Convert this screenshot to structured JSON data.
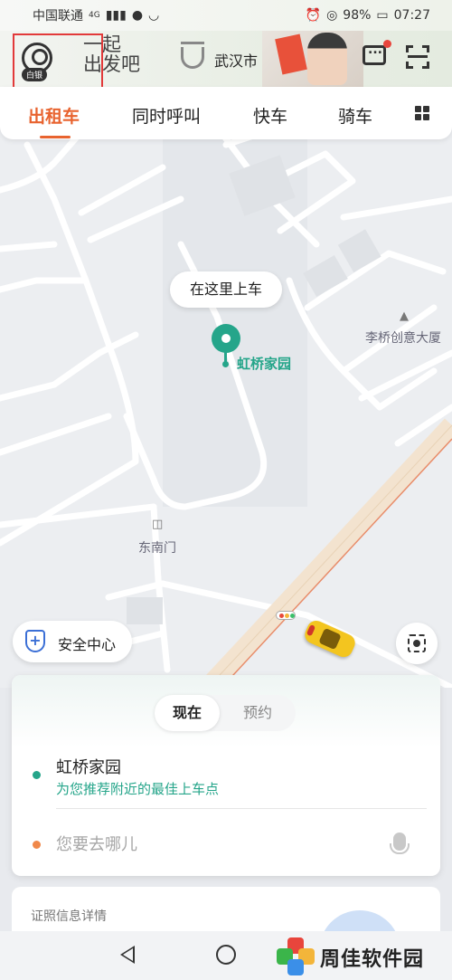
{
  "status_bar": {
    "carrier": "中国联通",
    "network": "4G",
    "battery": "98%",
    "time": "07:27"
  },
  "header": {
    "member_badge": "白银",
    "slogan_line1": "一起",
    "slogan_line2": "出发吧",
    "city": "武汉市"
  },
  "tabs": [
    {
      "label": "出租车",
      "active": true
    },
    {
      "label": "同时呼叫",
      "active": false
    },
    {
      "label": "快车",
      "active": false
    },
    {
      "label": "骑车",
      "active": false
    }
  ],
  "map": {
    "pickup_bubble": "在这里上车",
    "pickup_name": "虹桥家园",
    "poi_1": "李桥创意大厦",
    "poi_2": "东南门",
    "safety_center": "安全中心"
  },
  "booking": {
    "mode_now": "现在",
    "mode_later": "预约",
    "from_name": "虹桥家园",
    "from_hint": "为您推荐附近的最佳上车点",
    "to_placeholder": "您要去哪儿"
  },
  "license_card": {
    "label": "证照信息详情"
  },
  "watermark": {
    "text": "周佳软件园"
  },
  "colors": {
    "accent": "#e8632f",
    "pickup_green": "#25a58a",
    "destination_orange": "#f0884a",
    "safety_blue": "#3b6fd6"
  }
}
